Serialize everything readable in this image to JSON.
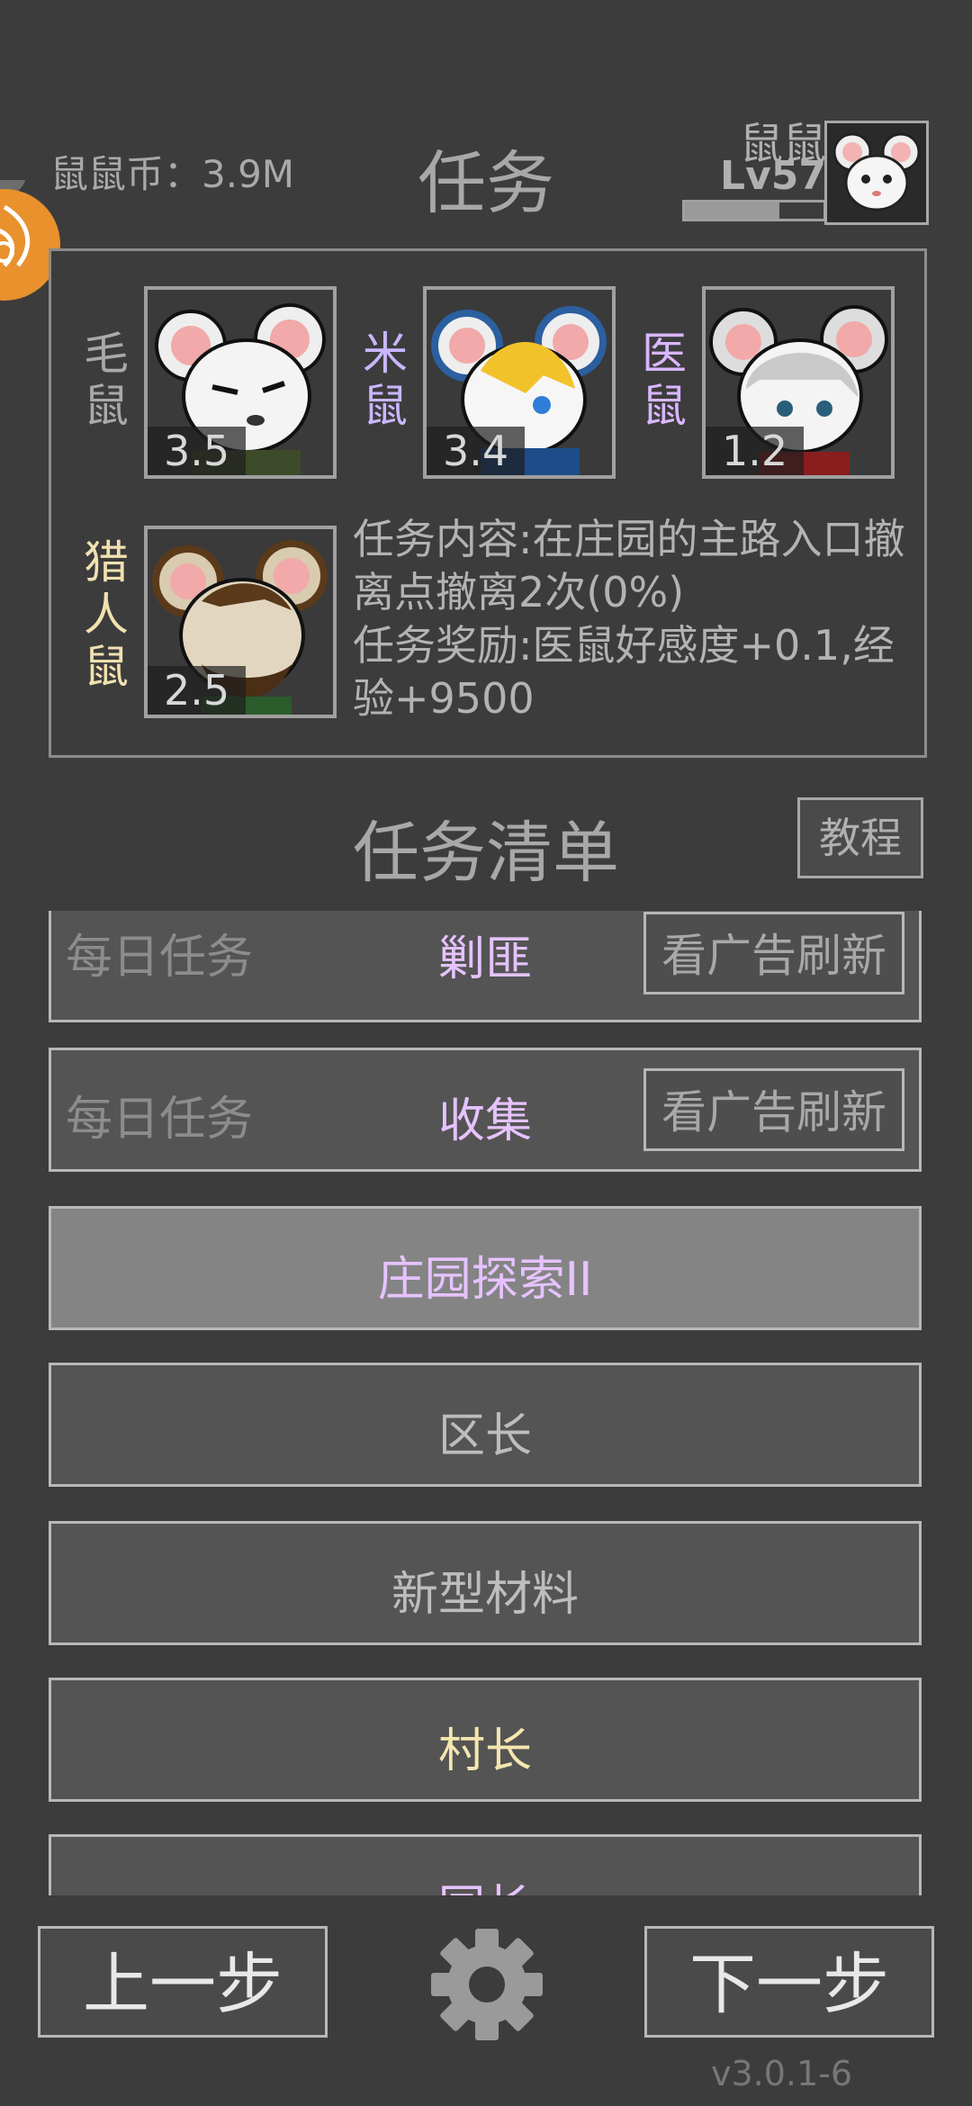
{
  "header": {
    "coins": "鼠鼠币：3.9M",
    "title": "任务",
    "player_name": "鼠鼠",
    "player_level": "Lv57",
    "xp_fraction": 0.68
  },
  "characters": [
    {
      "name": "毛鼠",
      "affinity": "3.5",
      "name_color": "#a9a9a9",
      "icon": "white-mouse-portrait"
    },
    {
      "name": "米鼠",
      "affinity": "3.4",
      "name_color": "#c9b6ff",
      "icon": "blonde-mouse-portrait"
    },
    {
      "name": "医鼠",
      "affinity": "1.2",
      "name_color": "#d9b6ff",
      "icon": "nurse-mouse-portrait"
    },
    {
      "name": "猎人鼠",
      "affinity": "2.5",
      "name_color": "#f1e1b0",
      "icon": "hunter-mouse-portrait"
    }
  ],
  "task": {
    "content": "任务内容:在庄园的主路入口撤离点撤离2次(0%)",
    "reward": "任务奖励:医鼠好感度+0.1,经验+9500"
  },
  "list": {
    "title": "任务清单",
    "tutorial_label": "教程",
    "daily_label": "每日任务",
    "refresh_label": "看广告刷新",
    "items": [
      {
        "label": "剿匪",
        "color": "#e6c3ff",
        "daily": true
      },
      {
        "label": "收集",
        "color": "#e6c3ff",
        "daily": true
      },
      {
        "label": "庄园探索II",
        "color": "#e6c3ff",
        "daily": false,
        "selected": true
      },
      {
        "label": "区长",
        "color": "#bdbdbd",
        "daily": false
      },
      {
        "label": "新型材料",
        "color": "#bdbdbd",
        "daily": false
      },
      {
        "label": "村长",
        "color": "#f5e6b0",
        "daily": false
      },
      {
        "label": "园长",
        "color": "#e6c3ff",
        "daily": false
      }
    ]
  },
  "footer": {
    "prev_label": "上一步",
    "next_label": "下一步",
    "version": "v3.0.1-6"
  }
}
